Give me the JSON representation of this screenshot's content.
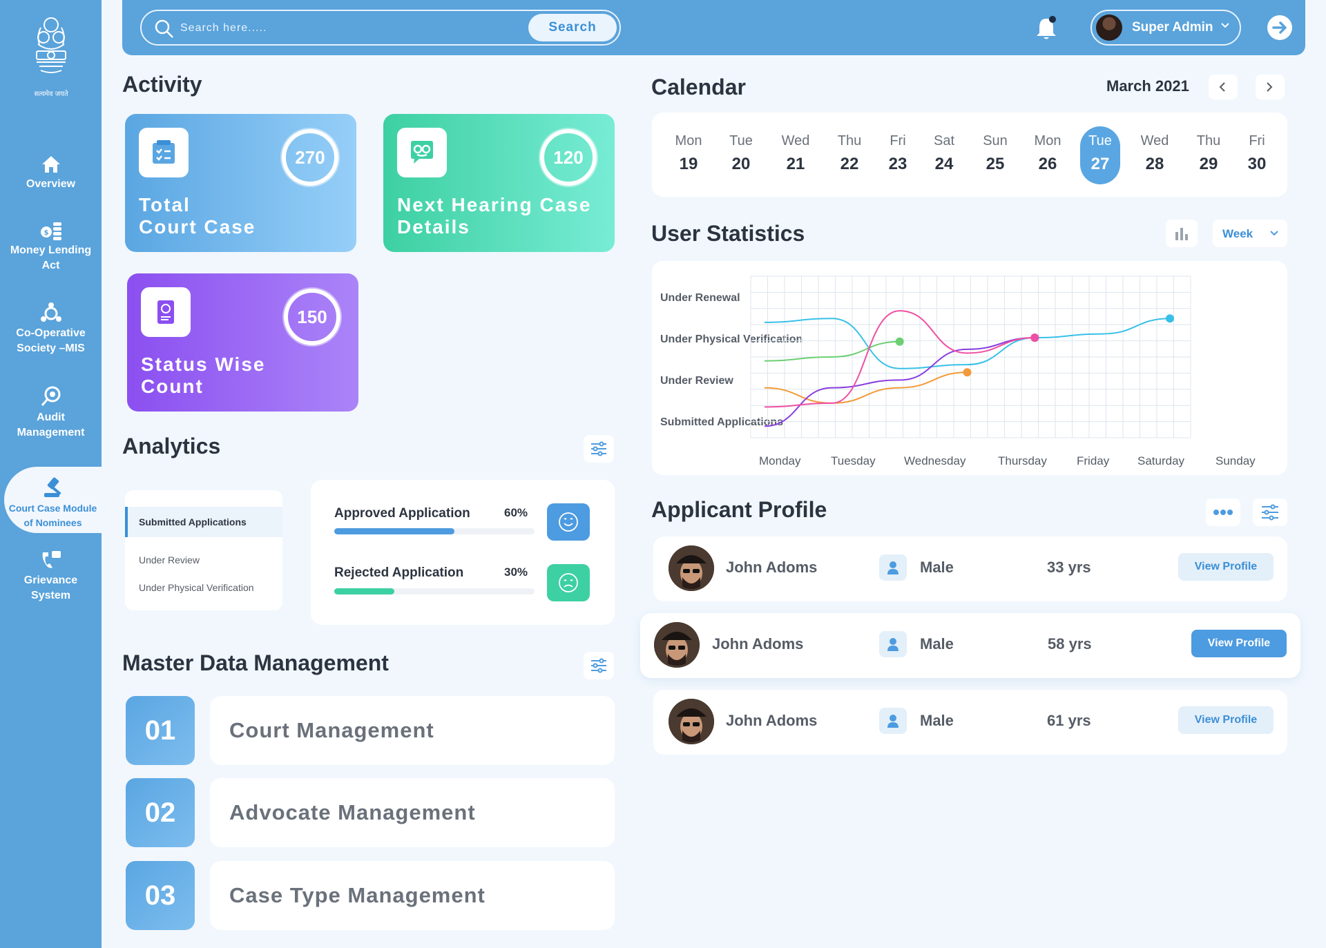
{
  "sidebar": {
    "emblem_caption": "सत्यमेव जयते",
    "items": [
      {
        "label_lines": [
          "Overview"
        ],
        "icon": "home-icon"
      },
      {
        "label_lines": [
          "Money Lending",
          "Act"
        ],
        "icon": "coins-icon"
      },
      {
        "label_lines": [
          "Co-Operative",
          "Society –MIS"
        ],
        "icon": "society-icon"
      },
      {
        "label_lines": [
          "Audit",
          "Management"
        ],
        "icon": "audit-icon"
      },
      {
        "label_lines": [
          "Court Case Module",
          "of Nominees"
        ],
        "icon": "gavel-icon",
        "active": true
      },
      {
        "label_lines": [
          "Grievance",
          "System"
        ],
        "icon": "grievance-icon"
      }
    ]
  },
  "topbar": {
    "search_placeholder": "Search here.....",
    "search_button": "Search",
    "user_name": "Super Admin",
    "icons": [
      "search-icon",
      "bell-icon",
      "chevron-down-icon",
      "logout-icon"
    ]
  },
  "activity": {
    "title": "Activity",
    "cards": [
      {
        "count": "270",
        "title_lines": [
          "Total",
          "Court Case"
        ],
        "icon": "checklist-icon"
      },
      {
        "count": "120",
        "title_lines": [
          "Next Hearing Case",
          "Details"
        ],
        "icon": "chat-icon"
      },
      {
        "count": "150",
        "title_lines": [
          "Status Wise",
          "Count"
        ],
        "icon": "document-icon"
      }
    ]
  },
  "analytics": {
    "title": "Analytics",
    "list": [
      "Submitted Applications",
      "Under Review",
      "Under Physical Verification"
    ],
    "bars": [
      {
        "label": "Approved Application",
        "percent_text": "60%",
        "value": 0.6,
        "color": "#4d9be0",
        "face": "smile-icon"
      },
      {
        "label": "Rejected Application",
        "percent_text": "30%",
        "value": 0.3,
        "color": "#3dd0a2",
        "face": "sad-icon"
      }
    ]
  },
  "master_data": {
    "title": "Master Data Management",
    "rows": [
      {
        "num": "01",
        "label": "Court Management"
      },
      {
        "num": "02",
        "label": "Advocate Management"
      },
      {
        "num": "03",
        "label": "Case Type Management"
      }
    ]
  },
  "calendar": {
    "title": "Calendar",
    "month": "March 2021",
    "days": [
      {
        "name": "Mon",
        "date": "19"
      },
      {
        "name": "Tue",
        "date": "20"
      },
      {
        "name": "Wed",
        "date": "21"
      },
      {
        "name": "Thu",
        "date": "22"
      },
      {
        "name": "Fri",
        "date": "23"
      },
      {
        "name": "Sat",
        "date": "24"
      },
      {
        "name": "Sun",
        "date": "25"
      },
      {
        "name": "Mon",
        "date": "26"
      },
      {
        "name": "Tue",
        "date": "27",
        "selected": true
      },
      {
        "name": "Wed",
        "date": "28"
      },
      {
        "name": "Thu",
        "date": "29"
      },
      {
        "name": "Fri",
        "date": "30"
      }
    ]
  },
  "user_statistics": {
    "title": "User Statistics",
    "period": "Week"
  },
  "chart_data": {
    "type": "line",
    "title": "",
    "x": [
      "Monday",
      "Tuesday",
      "Wednesday",
      "Thursday",
      "Friday",
      "Saturday",
      "Sunday"
    ],
    "y_categories": [
      "Under Renewal",
      "Under Physical Verification",
      "Under Review",
      "Submitted Applications"
    ],
    "grid": true,
    "series": [
      {
        "color": "#38c0e8",
        "values": [
          1.2,
          1.1,
          2.4,
          2.3,
          1.6,
          1.5,
          1.1
        ]
      },
      {
        "color": "#6ccf72",
        "values": [
          2.2,
          2.1,
          1.7
        ]
      },
      {
        "color": "#f59a3a",
        "values": [
          2.9,
          3.3,
          2.9,
          2.5
        ]
      },
      {
        "color": "#8a3ee0",
        "values": [
          3.9,
          2.9,
          2.7,
          1.9,
          1.6
        ]
      },
      {
        "color": "#ef4fa2",
        "values": [
          3.4,
          3.3,
          0.9,
          2.0,
          1.6
        ]
      }
    ]
  },
  "applicant_profile": {
    "title": "Applicant Profile",
    "rows": [
      {
        "name": "John Adoms",
        "gender": "Male",
        "age": "33 yrs",
        "button": "View Profile"
      },
      {
        "name": "John Adoms",
        "gender": "Male",
        "age": "58 yrs",
        "button": "View Profile",
        "highlight": true
      },
      {
        "name": "John Adoms",
        "gender": "Male",
        "age": "61 yrs",
        "button": "View Profile"
      }
    ]
  }
}
